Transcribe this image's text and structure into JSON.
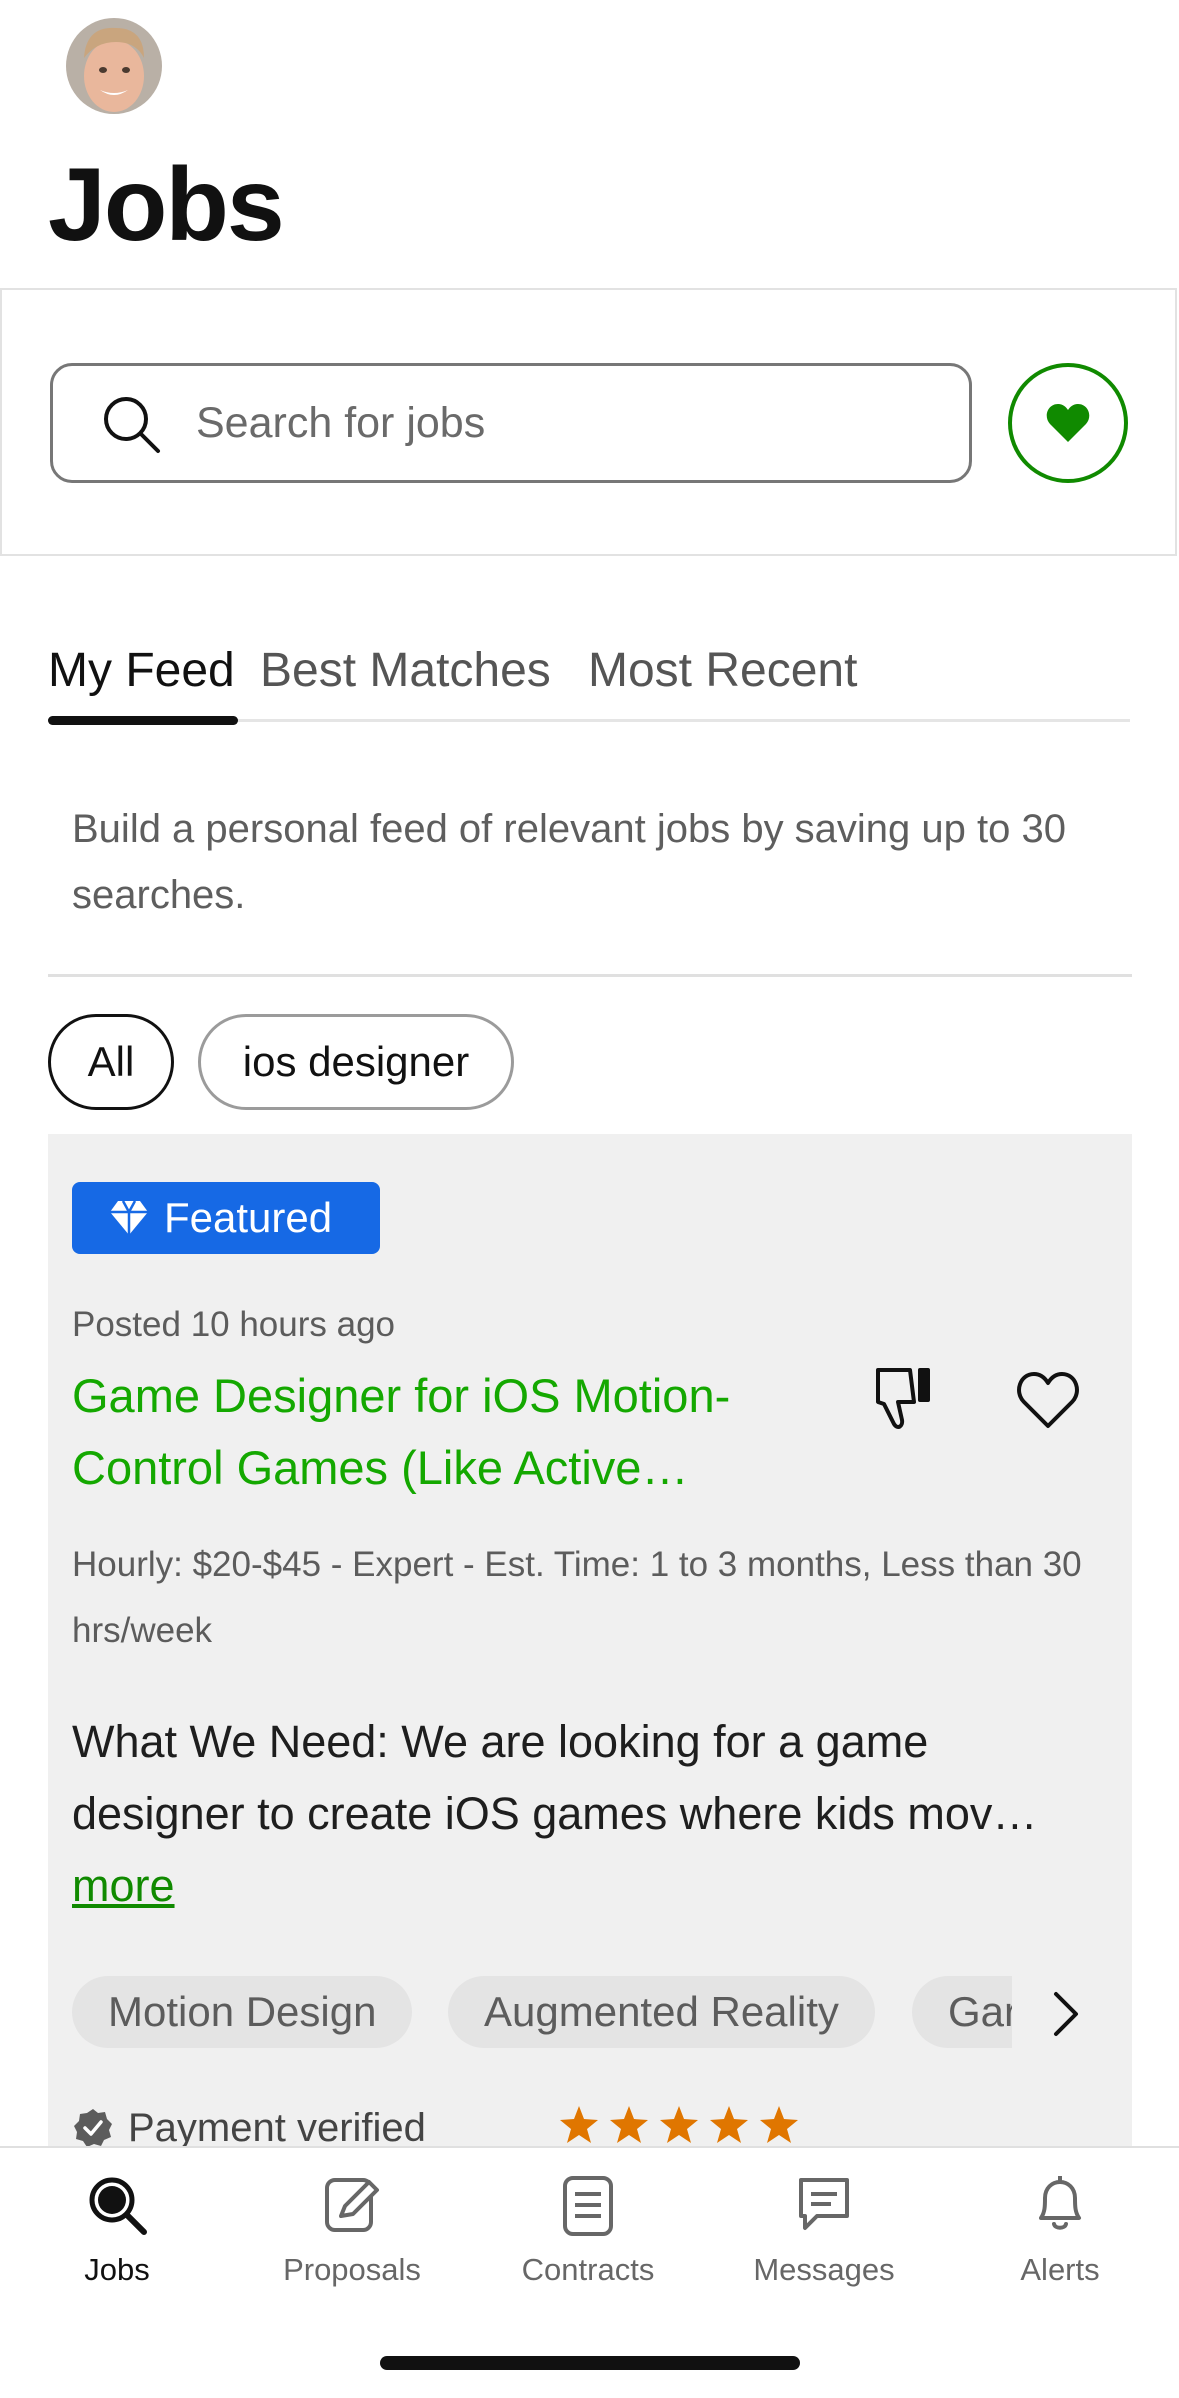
{
  "header": {
    "title": "Jobs"
  },
  "search": {
    "placeholder": "Search for jobs"
  },
  "tabs": [
    {
      "label": "My Feed",
      "active": true
    },
    {
      "label": "Best Matches",
      "active": false
    },
    {
      "label": "Most Recent",
      "active": false
    }
  ],
  "feed_hint": "Build a personal feed of relevant jobs by saving up to 30 searches.",
  "filters": [
    {
      "label": "All",
      "selected": true
    },
    {
      "label": "ios designer",
      "selected": false
    }
  ],
  "job": {
    "badge": "Featured",
    "posted": "Posted 10 hours ago",
    "title": "Game Designer for iOS Motion-Control Games (Like Active…",
    "meta": "Hourly: $20-$45 - Expert - Est. Time: 1 to 3 months, Less than 30 hrs/week",
    "description": "What We Need: We are looking for a game designer to create iOS games where kids mov…",
    "more_label": "more",
    "skills": [
      "Motion Design",
      "Augmented Reality",
      "Gar"
    ],
    "payment": "Payment verified",
    "rating": 5
  },
  "nav": [
    {
      "label": "Jobs",
      "icon": "search-icon",
      "active": true
    },
    {
      "label": "Proposals",
      "icon": "proposal-icon",
      "active": false
    },
    {
      "label": "Contracts",
      "icon": "contract-icon",
      "active": false
    },
    {
      "label": "Messages",
      "icon": "message-icon",
      "active": false
    },
    {
      "label": "Alerts",
      "icon": "bell-icon",
      "active": false
    }
  ],
  "colors": {
    "accent_green": "#14a800",
    "link_green": "#108a00",
    "featured_blue": "#1669e5",
    "star_orange": "#e07600"
  }
}
